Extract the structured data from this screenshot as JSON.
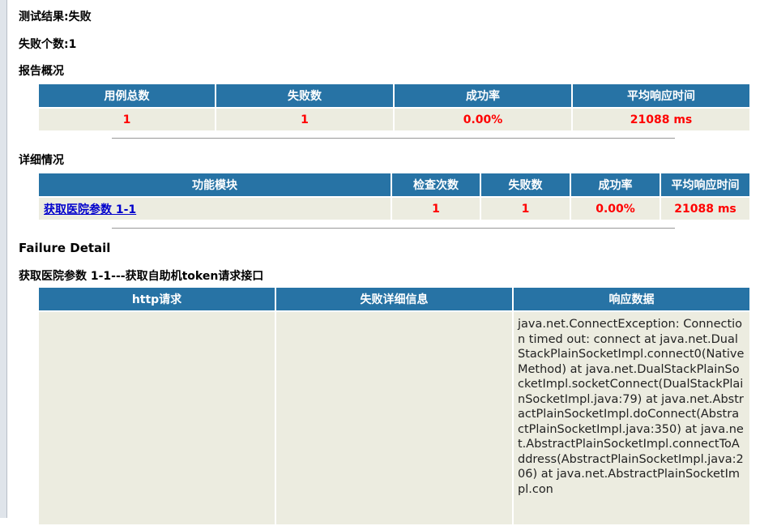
{
  "summary": {
    "result_label": "测试结果:",
    "result_value": "失败",
    "fail_count_label": "失败个数:",
    "fail_count_value": "1",
    "overview_title": "报告概况"
  },
  "overview": {
    "headers": [
      "用例总数",
      "失败数",
      "成功率",
      "平均响应时间"
    ],
    "values": [
      "1",
      "1",
      "0.00%",
      "21088 ms"
    ]
  },
  "detail": {
    "title": "详细情况",
    "headers": [
      "功能模块",
      "检查次数",
      "失败数",
      "成功率",
      "平均响应时间"
    ],
    "row": {
      "module": "获取医院参数 1-1",
      "checks": "1",
      "fails": "1",
      "rate": "0.00%",
      "avg": "21088 ms"
    }
  },
  "failure": {
    "title": "Failure Detail",
    "subtitle": "获取医院参数 1-1---获取自助机token请求接口",
    "headers": [
      "http请求",
      "失败详细信息",
      "响应数据"
    ],
    "http_request": "",
    "fail_info": "",
    "response": "java.net.ConnectException: Connection timed out: connect at java.net.DualStackPlainSocketImpl.connect0(Native Method) at java.net.DualStackPlainSocketImpl.socketConnect(DualStackPlainSocketImpl.java:79) at java.net.AbstractPlainSocketImpl.doConnect(AbstractPlainSocketImpl.java:350) at java.net.AbstractPlainSocketImpl.connectToAddress(AbstractPlainSocketImpl.java:206) at java.net.AbstractPlainSocketImpl.con"
  }
}
